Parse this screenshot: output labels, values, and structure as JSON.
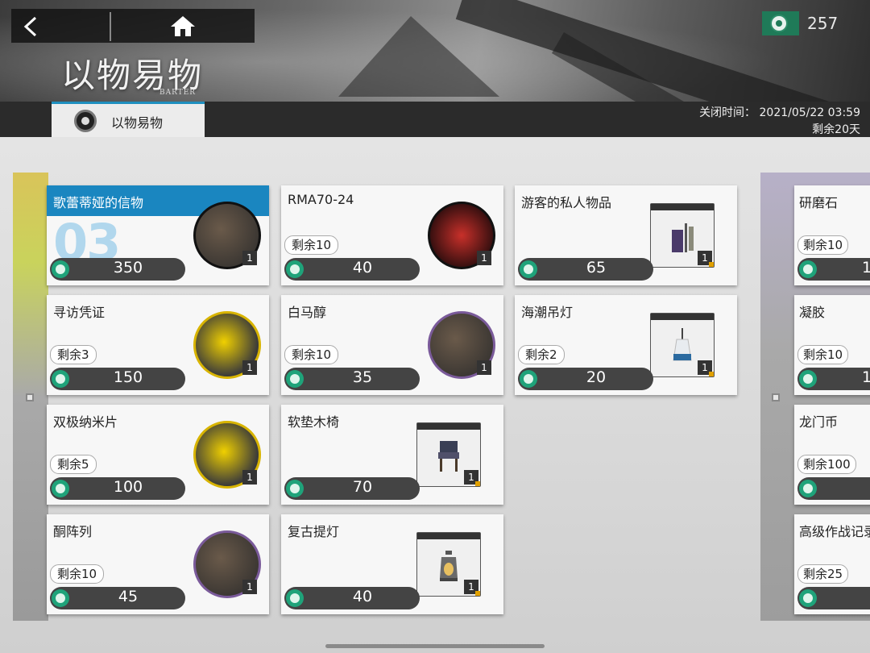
{
  "header": {
    "title": "以物易物",
    "subtitle": "BARTER",
    "currency_amount": "257"
  },
  "tab": {
    "label": "以物易物"
  },
  "event": {
    "close_time": "关闭时间： 2021/05/22 03:59",
    "remaining": "剩余20天"
  },
  "items": [
    {
      "name": "歌蕾蒂娅的信物",
      "big_number": "03",
      "price": "350",
      "qty": "1"
    },
    {
      "name": "RMA70-24",
      "stock": "剩余10",
      "price": "40",
      "qty": "1"
    },
    {
      "name": "游客的私人物品",
      "price": "65",
      "qty": "1"
    },
    {
      "name": "寻访凭证",
      "stock": "剩余3",
      "price": "150",
      "qty": "1"
    },
    {
      "name": "白马醇",
      "stock": "剩余10",
      "price": "35",
      "qty": "1"
    },
    {
      "name": "海潮吊灯",
      "stock": "剩余2",
      "price": "20",
      "qty": "1"
    },
    {
      "name": "双极纳米片",
      "stock": "剩余5",
      "price": "100",
      "qty": "1"
    },
    {
      "name": "软垫木椅",
      "price": "70",
      "qty": "1"
    },
    {
      "name": "酮阵列",
      "stock": "剩余10",
      "price": "45",
      "qty": "1"
    },
    {
      "name": "复古提灯",
      "price": "40",
      "qty": "1"
    }
  ],
  "side_items": [
    {
      "name": "研磨石",
      "stock": "剩余10",
      "price": "1"
    },
    {
      "name": "凝胶",
      "stock": "剩余10",
      "price": "1"
    },
    {
      "name": "龙门币",
      "stock": "剩余100"
    },
    {
      "name": "高级作战记录",
      "stock": "剩余25"
    }
  ],
  "colors": {
    "accent_blue": "#1a86c0",
    "currency_green": "#1fa37a",
    "price_bar": "#444444"
  }
}
